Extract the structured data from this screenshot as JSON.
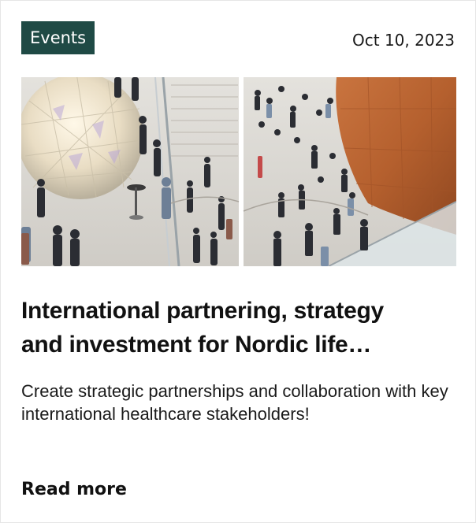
{
  "card": {
    "category": "Events",
    "date": "Oct 10, 2023",
    "title_lines": [
      "International partnering, strategy",
      "and investment for Nordic life…"
    ],
    "description": "Create strategic partnerships and collaboration with key international healthcare stakeholders!",
    "read_more_label": "Read more"
  },
  "colors": {
    "badge_bg": "#1f4a45",
    "text": "#111111"
  }
}
